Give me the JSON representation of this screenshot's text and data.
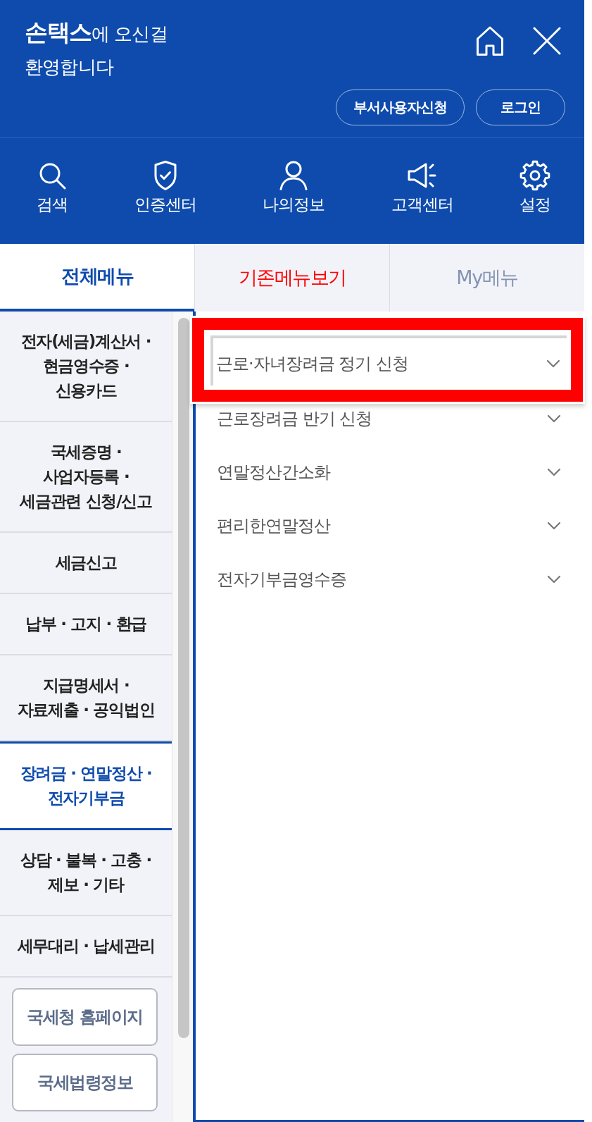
{
  "header": {
    "title": "**손택스**에 오신걸\n환영합니다",
    "buttons": [
      "부서사용자신청",
      "로그인"
    ]
  },
  "quick_menu": [
    {
      "label": "검색"
    },
    {
      "label": "인증센터"
    },
    {
      "label": "나의정보"
    },
    {
      "label": "고객센터"
    },
    {
      "label": "설정"
    }
  ],
  "tabs": [
    {
      "label": "전체메뉴",
      "selected": true,
      "color": "#0e4bad"
    },
    {
      "label": "기존메뉴보기",
      "selected": false,
      "color": "#ff0000"
    },
    {
      "label": "My메뉴",
      "selected": false,
      "color": "#8493b2"
    }
  ],
  "side_menu": {
    "items": [
      {
        "label": "전자(세금)계산서 ·\n현금영수증 ·\n신용카드",
        "selected": false
      },
      {
        "label": "국세증명 ·\n사업자등록 ·\n세금관련 신청/신고",
        "selected": false
      },
      {
        "label": "세금신고",
        "selected": false
      },
      {
        "label": "납부 · 고지 · 환급",
        "selected": false
      },
      {
        "label": "지급명세서 ·\n자료제출 · 공익법인",
        "selected": false
      },
      {
        "label": "장려금 · 연말정산 ·\n전자기부금",
        "selected": true
      },
      {
        "label": "상담 · 불복 · 고충 ·\n제보 · 기타",
        "selected": false
      },
      {
        "label": "세무대리 · 납세관리",
        "selected": false
      }
    ],
    "links": [
      "국세청 홈페이지",
      "국세법령정보"
    ]
  },
  "submenu": {
    "items": [
      {
        "label": "근로·자녀장려금 정기 신청",
        "highlighted": true
      },
      {
        "label": "근로장려금 반기 신청",
        "highlighted": false
      },
      {
        "label": "연말정산간소화",
        "highlighted": false
      },
      {
        "label": "편리한연말정산",
        "highlighted": false
      },
      {
        "label": "전자기부금영수증",
        "highlighted": false
      }
    ]
  }
}
